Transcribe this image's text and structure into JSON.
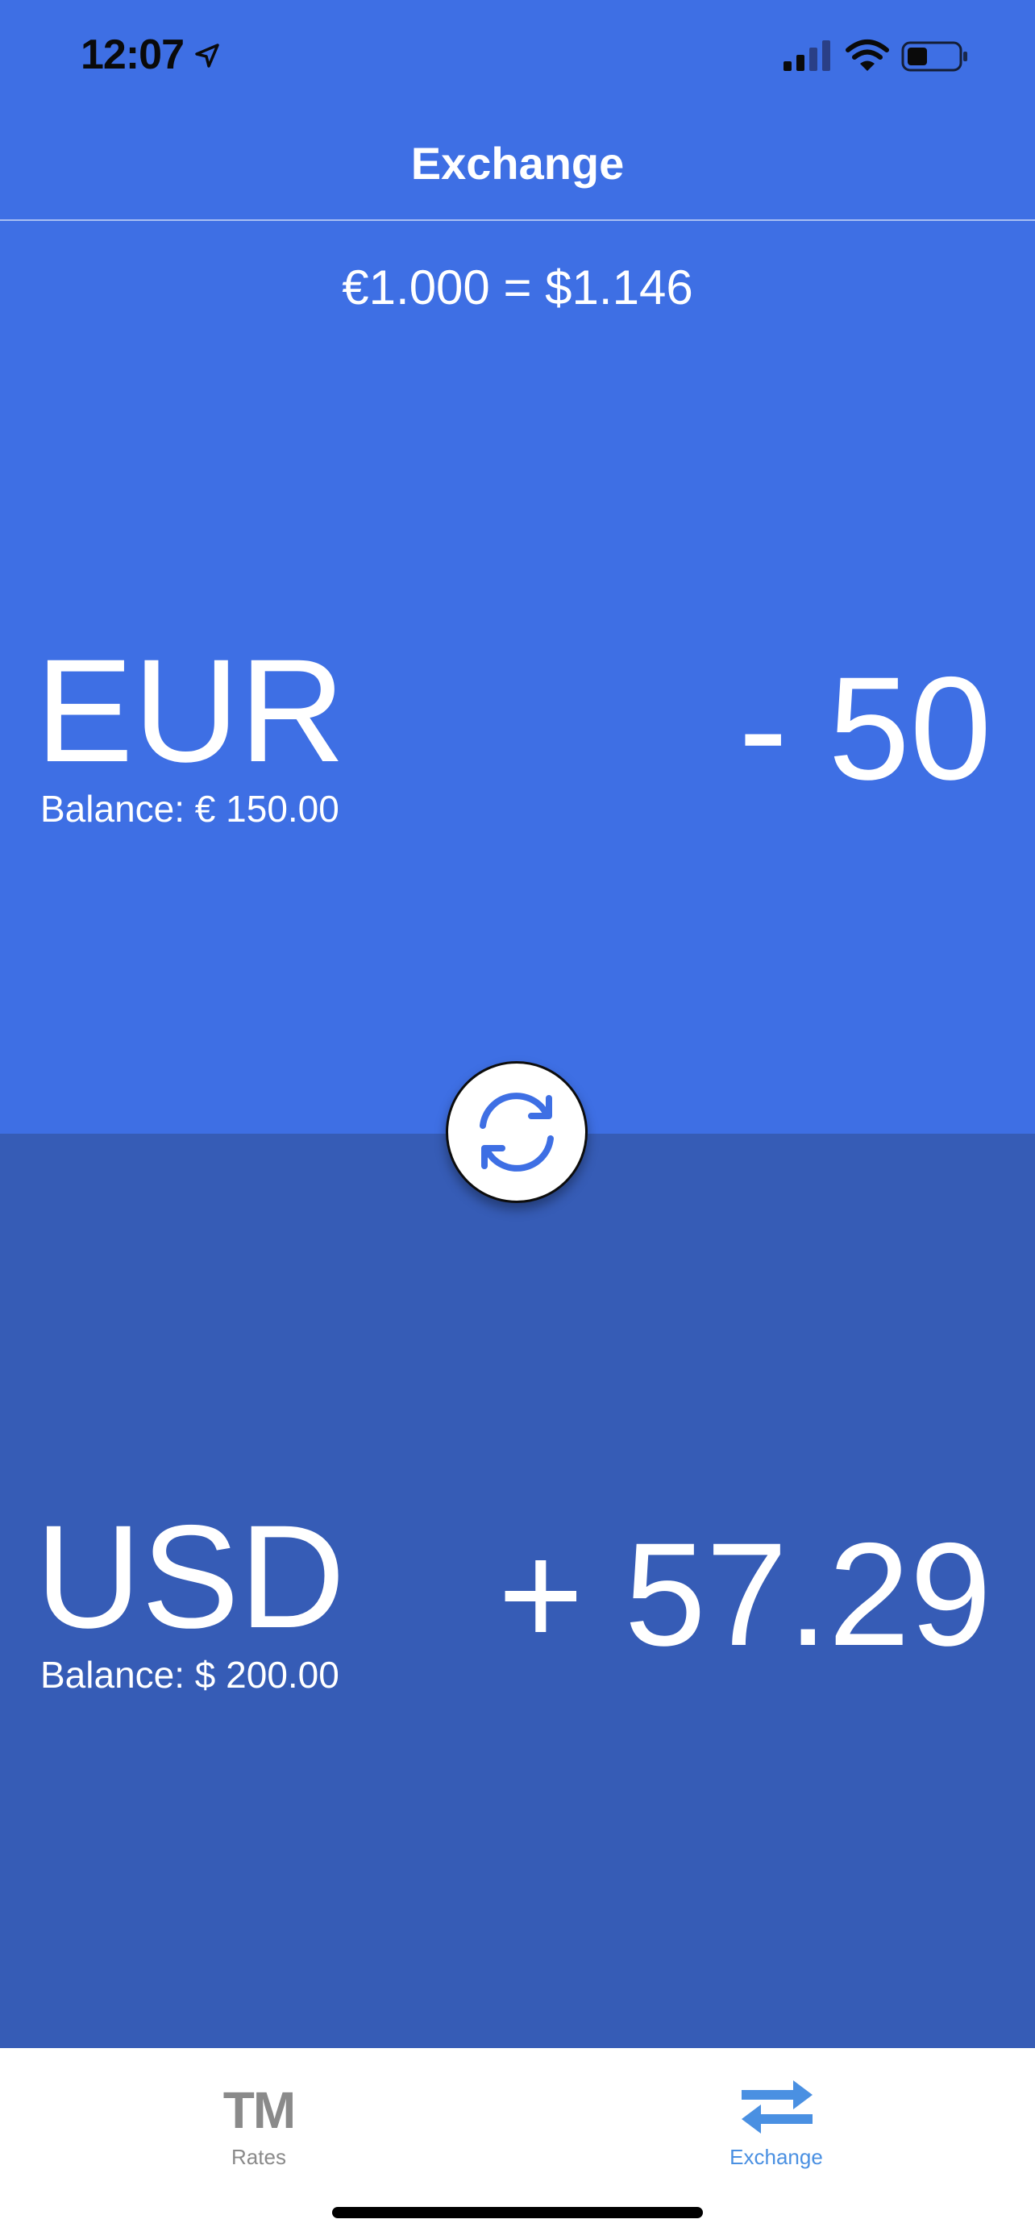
{
  "status_bar": {
    "time": "12:07"
  },
  "header": {
    "title": "Exchange"
  },
  "rate": {
    "text": "€1.000 = $1.146"
  },
  "from_currency": {
    "code": "EUR",
    "balance": "Balance: € 150.00",
    "amount": "- 50"
  },
  "to_currency": {
    "code": "USD",
    "balance": "Balance: $ 200.00",
    "amount": "+ 57.29"
  },
  "tab_bar": {
    "tabs": [
      {
        "label": "Rates",
        "icon_text": "TM",
        "icon": "tm-icon",
        "active": false
      },
      {
        "label": "Exchange",
        "icon": "exchange-arrows-icon",
        "active": true
      }
    ]
  },
  "colors": {
    "top_background": "#3E6FE4",
    "bottom_background": "#365CB6",
    "active_tab": "#4A90E2",
    "inactive_tab": "#8A8A8A"
  }
}
